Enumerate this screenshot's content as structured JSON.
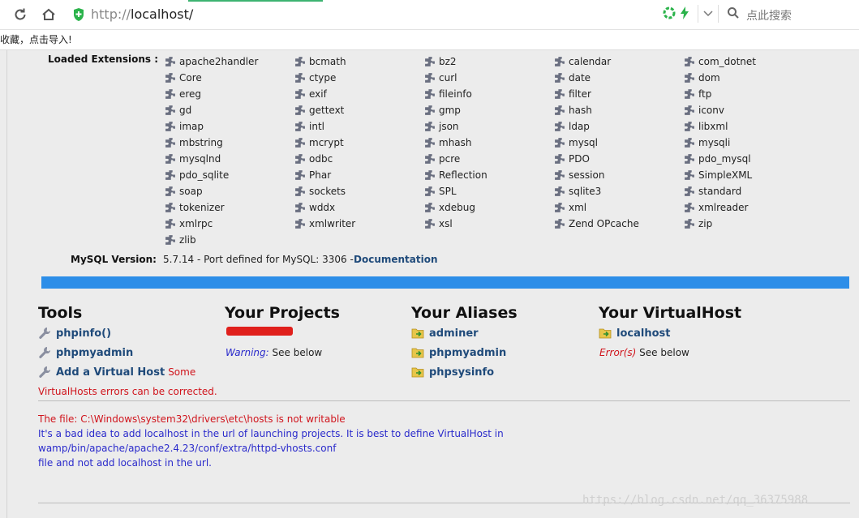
{
  "browser": {
    "url_scheme": "http://",
    "url_host": "localhost/",
    "search_placeholder": "点此搜索",
    "bookmarks_text": "收藏，点击导入!"
  },
  "extensions": {
    "label": "Loaded Extensions :",
    "columns": [
      [
        "apache2handler",
        "Core",
        "ereg",
        "gd",
        "imap",
        "mbstring",
        "mysqlnd",
        "pdo_sqlite",
        "soap",
        "tokenizer",
        "xmlrpc",
        "zlib"
      ],
      [
        "bcmath",
        "ctype",
        "exif",
        "gettext",
        "intl",
        "mcrypt",
        "odbc",
        "Phar",
        "sockets",
        "wddx",
        "xmlwriter"
      ],
      [
        "bz2",
        "curl",
        "fileinfo",
        "gmp",
        "json",
        "mhash",
        "pcre",
        "Reflection",
        "SPL",
        "xdebug",
        "xsl"
      ],
      [
        "calendar",
        "date",
        "filter",
        "hash",
        "ldap",
        "mysql",
        "PDO",
        "session",
        "sqlite3",
        "xml",
        "Zend OPcache"
      ],
      [
        "com_dotnet",
        "dom",
        "ftp",
        "iconv",
        "libxml",
        "mysqli",
        "pdo_mysql",
        "SimpleXML",
        "standard",
        "xmlreader",
        "zip"
      ]
    ]
  },
  "mysql": {
    "label": "MySQL Version:",
    "value": "5.7.14 - Port defined for MySQL: 3306 -",
    "doc_link": "Documentation"
  },
  "tools": {
    "title": "Tools",
    "items": [
      "phpinfo()",
      "phpmyadmin",
      "Add a Virtual Host"
    ],
    "add_vhost_suffix": "Some",
    "errors_note": "VirtualHosts errors can be corrected."
  },
  "projects": {
    "title": "Your Projects",
    "warning_label": "Warning:",
    "warning_text": "See below"
  },
  "aliases": {
    "title": "Your Aliases",
    "items": [
      "adminer",
      "phpmyadmin",
      "phpsysinfo"
    ]
  },
  "vhost": {
    "title": "Your VirtualHost",
    "item": "localhost",
    "error_label": "Error(s)",
    "error_text": "See below"
  },
  "messages": {
    "line1": "The file: C:\\Windows\\system32\\drivers\\etc\\hosts is not writable",
    "line2": "It's a bad idea to add localhost in the url of launching projects. It is best to define VirtualHost in",
    "line3": "wamp/bin/apache/apache2.4.23/conf/extra/httpd-vhosts.conf",
    "line4": "file and not add localhost in the url."
  },
  "watermark": "https://blog.csdn.net/qq_36375988",
  "colors": {
    "link": "#1f4a7a",
    "error": "#d0141c",
    "info": "#2a2acb",
    "bar": "#2d8ee8"
  }
}
